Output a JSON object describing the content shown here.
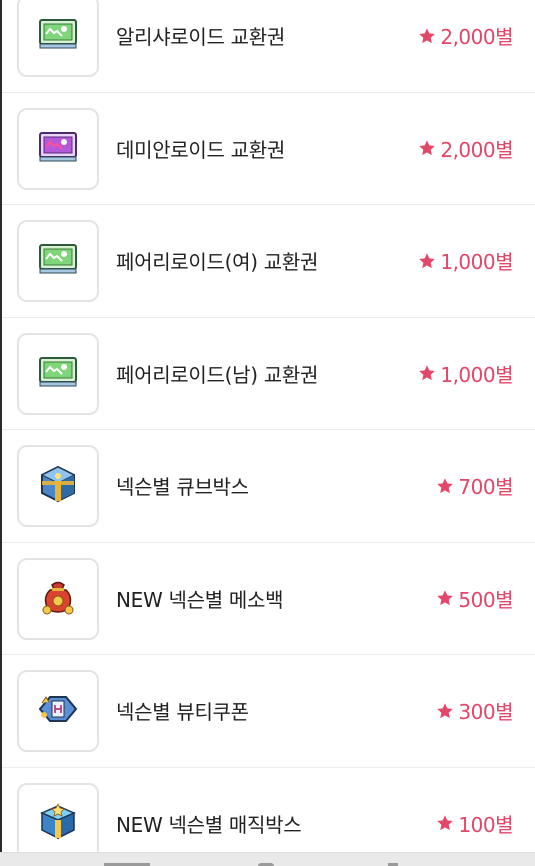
{
  "colors": {
    "price": "#e44668",
    "border": "#e4e4e4",
    "divider": "#ececec"
  },
  "items": [
    {
      "name": "알리샤로이드 교환권",
      "price": "2,000별",
      "icon": "ticket-green-icon"
    },
    {
      "name": "데미안로이드 교환권",
      "price": "2,000별",
      "icon": "ticket-purple-icon"
    },
    {
      "name": "페어리로이드(여) 교환권",
      "price": "1,000별",
      "icon": "ticket-green-icon"
    },
    {
      "name": "페어리로이드(남) 교환권",
      "price": "1,000별",
      "icon": "ticket-green-icon"
    },
    {
      "name": "넥슨별 큐브박스",
      "price": "700별",
      "icon": "cube-box-icon"
    },
    {
      "name": "NEW 넥슨별 메소백",
      "price": "500별",
      "icon": "meso-bag-icon"
    },
    {
      "name": "넥슨별 뷰티쿠폰",
      "price": "300별",
      "icon": "beauty-coupon-icon"
    },
    {
      "name": "NEW 넥슨별 매직박스",
      "price": "100별",
      "icon": "magic-box-icon"
    }
  ]
}
